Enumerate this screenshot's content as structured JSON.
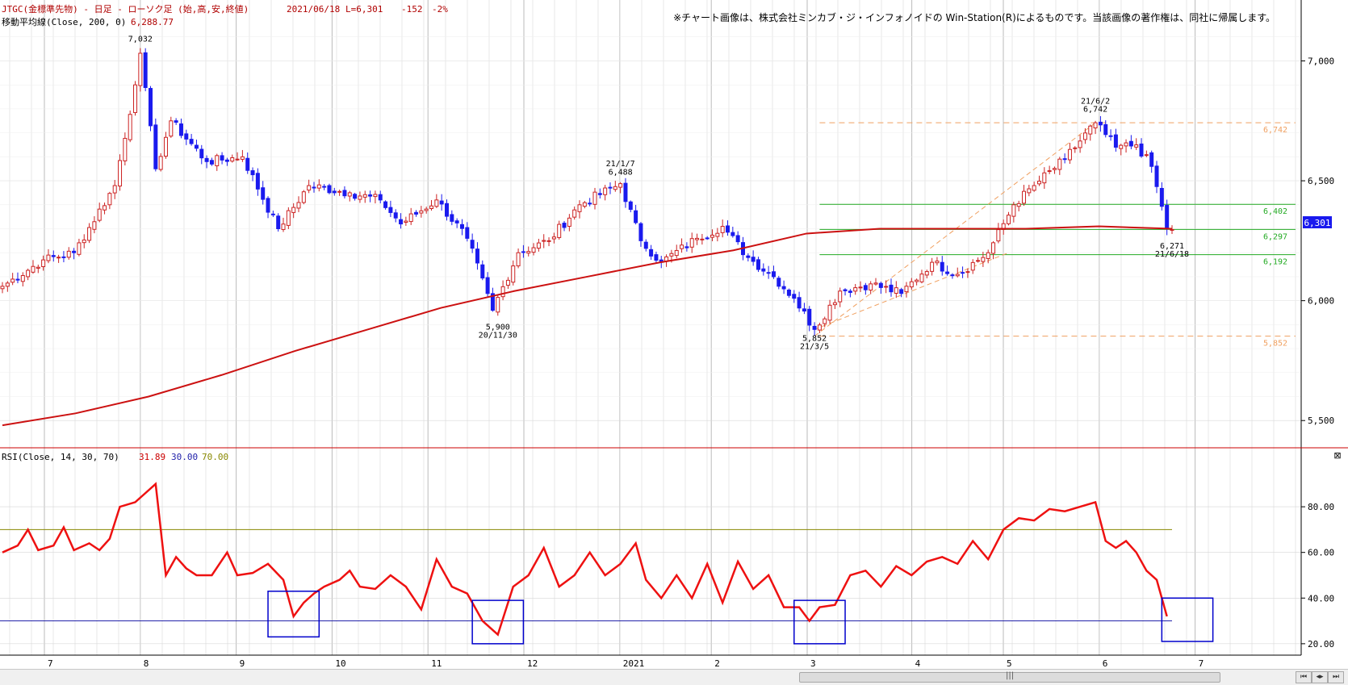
{
  "header": {
    "title": "JTGC(金標準先物) - 日足 - ローソク足 (始,高,安,終値)",
    "date": "2021/06/18",
    "last": "L=6,301",
    "change": "-152",
    "pct": "-2%",
    "ma_label": "移動平均線(Close, 200, 0)",
    "ma_value": "6,288.77",
    "copyright": "※チャート画像は、株式会社ミンカブ・ジ・インフォノイドの Win-Station(R)によるものです。当該画像の著作権は、同社に帰属します。"
  },
  "rsi_header": {
    "label": "RSI(Close, 14, 30, 70)",
    "value": "31.89",
    "lower": "30.00",
    "upper": "70.00"
  },
  "colors": {
    "up": "#cc2222",
    "down": "#1a1aee",
    "ma": "#cc1111",
    "rsi": "#ee1111",
    "level_lower": "#2222aa",
    "level_upper": "#888800",
    "support": "#22aa22",
    "dashed": "#f0a060",
    "grid": "#d8d8d8",
    "price_tag": "#1a1aee"
  },
  "chart_data": [
    {
      "type": "candlestick",
      "title": "JTGC(金標準先物) - 日足 - ローソク足 (始,高,安,終値)",
      "x_tick_labels": [
        "7",
        "8",
        "9",
        "10",
        "11",
        "12",
        "2021",
        "2",
        "3",
        "4",
        "5",
        "6",
        "7"
      ],
      "y_tick_labels": [
        "7,000",
        "6,500",
        "6,000",
        "5,500"
      ],
      "ylim": [
        5420,
        7180
      ],
      "moving_average": {
        "name": "移動平均線(Close, 200, 0)",
        "points": [
          [
            0,
            5480
          ],
          [
            15,
            5530
          ],
          [
            30,
            5600
          ],
          [
            45,
            5690
          ],
          [
            60,
            5790
          ],
          [
            75,
            5880
          ],
          [
            90,
            5970
          ],
          [
            105,
            6040
          ],
          [
            120,
            6100
          ],
          [
            135,
            6160
          ],
          [
            150,
            6210
          ],
          [
            165,
            6280
          ],
          [
            180,
            6300
          ],
          [
            195,
            6300
          ],
          [
            210,
            6300
          ],
          [
            225,
            6310
          ],
          [
            240,
            6300
          ]
        ]
      },
      "anchors": [
        {
          "i": 0,
          "p": 6060
        },
        {
          "i": 8,
          "p": 6170
        },
        {
          "i": 14,
          "p": 6200
        },
        {
          "i": 22,
          "p": 6480
        },
        {
          "i": 26,
          "p": 6900
        },
        {
          "i": 27,
          "p": 7032
        },
        {
          "i": 30,
          "p": 6550
        },
        {
          "i": 33,
          "p": 6750
        },
        {
          "i": 40,
          "p": 6580
        },
        {
          "i": 47,
          "p": 6600
        },
        {
          "i": 54,
          "p": 6300
        },
        {
          "i": 60,
          "p": 6480
        },
        {
          "i": 68,
          "p": 6450
        },
        {
          "i": 74,
          "p": 6420
        },
        {
          "i": 78,
          "p": 6320
        },
        {
          "i": 85,
          "p": 6420
        },
        {
          "i": 91,
          "p": 6260
        },
        {
          "i": 96,
          "p": 5960
        },
        {
          "i": 101,
          "p": 6200
        },
        {
          "i": 107,
          "p": 6250
        },
        {
          "i": 113,
          "p": 6400
        },
        {
          "i": 121,
          "p": 6488
        },
        {
          "i": 125,
          "p": 6250
        },
        {
          "i": 129,
          "p": 6160
        },
        {
          "i": 136,
          "p": 6260
        },
        {
          "i": 141,
          "p": 6310
        },
        {
          "i": 146,
          "p": 6180
        },
        {
          "i": 151,
          "p": 6100
        },
        {
          "i": 155,
          "p": 6010
        },
        {
          "i": 159,
          "p": 5880
        },
        {
          "i": 164,
          "p": 6040
        },
        {
          "i": 170,
          "p": 6070
        },
        {
          "i": 176,
          "p": 6030
        },
        {
          "i": 182,
          "p": 6160
        },
        {
          "i": 187,
          "p": 6110
        },
        {
          "i": 193,
          "p": 6200
        },
        {
          "i": 198,
          "p": 6400
        },
        {
          "i": 202,
          "p": 6480
        },
        {
          "i": 208,
          "p": 6590
        },
        {
          "i": 214,
          "p": 6742
        },
        {
          "i": 218,
          "p": 6640
        },
        {
          "i": 222,
          "p": 6650
        },
        {
          "i": 225,
          "p": 6560
        },
        {
          "i": 228,
          "p": 6301
        }
      ],
      "annotations": [
        {
          "label": "7,032",
          "i": 27,
          "p": 7080,
          "a": "middle"
        },
        {
          "label": "5,900",
          "i": 97,
          "p": 5880,
          "a": "middle"
        },
        {
          "label": "20/11/30",
          "i": 97,
          "p": 5846,
          "a": "middle"
        },
        {
          "label": "21/1/7",
          "i": 121,
          "p": 6560,
          "a": "middle"
        },
        {
          "label": "6,488",
          "i": 121,
          "p": 6526,
          "a": "middle"
        },
        {
          "label": "5,852",
          "i": 159,
          "p": 5832,
          "a": "middle"
        },
        {
          "label": "21/3/5",
          "i": 159,
          "p": 5798,
          "a": "middle"
        },
        {
          "label": "21/6/2",
          "i": 214,
          "p": 6822,
          "a": "middle"
        },
        {
          "label": "6,742",
          "i": 214,
          "p": 6788,
          "a": "middle"
        },
        {
          "label": "6,271",
          "i": 229,
          "p": 6218,
          "a": "middle"
        },
        {
          "label": "21/6/18",
          "i": 229,
          "p": 6184,
          "a": "middle"
        }
      ],
      "horizontal_lines": [
        {
          "value": 6742,
          "label": "6,742",
          "style": "dashed",
          "color": "#f0a060"
        },
        {
          "value": 6402,
          "label": "6,402",
          "style": "solid",
          "color": "#22aa22"
        },
        {
          "value": 6297,
          "label": "6,297",
          "style": "solid",
          "color": "#22aa22"
        },
        {
          "value": 6192,
          "label": "6,192",
          "style": "solid",
          "color": "#22aa22"
        },
        {
          "value": 5852,
          "label": "5,852",
          "style": "dashed",
          "color": "#f0a060"
        }
      ],
      "last_price_tag": "6,301"
    },
    {
      "type": "line",
      "title": "RSI(Close, 14, 30, 70)",
      "y_tick_labels": [
        "80.00",
        "60.00",
        "40.00",
        "20.00"
      ],
      "ylim": [
        15,
        97
      ],
      "levels": [
        30,
        70
      ],
      "series": [
        {
          "name": "RSI",
          "points": [
            [
              0,
              60
            ],
            [
              3,
              63
            ],
            [
              5,
              70
            ],
            [
              7,
              61
            ],
            [
              10,
              63
            ],
            [
              12,
              71
            ],
            [
              14,
              61
            ],
            [
              17,
              64
            ],
            [
              19,
              61
            ],
            [
              21,
              66
            ],
            [
              23,
              80
            ],
            [
              26,
              82
            ],
            [
              28,
              86
            ],
            [
              30,
              90
            ],
            [
              32,
              50
            ],
            [
              34,
              58
            ],
            [
              36,
              53
            ],
            [
              38,
              50
            ],
            [
              41,
              50
            ],
            [
              44,
              60
            ],
            [
              46,
              50
            ],
            [
              49,
              51
            ],
            [
              52,
              55
            ],
            [
              55,
              48
            ],
            [
              57,
              32
            ],
            [
              59,
              38
            ],
            [
              61,
              42
            ],
            [
              63,
              45
            ],
            [
              66,
              48
            ],
            [
              68,
              52
            ],
            [
              70,
              45
            ],
            [
              73,
              44
            ],
            [
              76,
              50
            ],
            [
              79,
              45
            ],
            [
              82,
              35
            ],
            [
              85,
              57
            ],
            [
              88,
              45
            ],
            [
              91,
              42
            ],
            [
              94,
              30
            ],
            [
              97,
              24
            ],
            [
              100,
              45
            ],
            [
              103,
              50
            ],
            [
              106,
              62
            ],
            [
              109,
              45
            ],
            [
              112,
              50
            ],
            [
              115,
              60
            ],
            [
              118,
              50
            ],
            [
              121,
              55
            ],
            [
              124,
              64
            ],
            [
              126,
              48
            ],
            [
              129,
              40
            ],
            [
              132,
              50
            ],
            [
              135,
              40
            ],
            [
              138,
              55
            ],
            [
              141,
              38
            ],
            [
              144,
              56
            ],
            [
              147,
              44
            ],
            [
              150,
              50
            ],
            [
              153,
              36
            ],
            [
              156,
              36
            ],
            [
              158,
              30
            ],
            [
              160,
              36
            ],
            [
              163,
              37
            ],
            [
              166,
              50
            ],
            [
              169,
              52
            ],
            [
              172,
              45
            ],
            [
              175,
              54
            ],
            [
              178,
              50
            ],
            [
              181,
              56
            ],
            [
              184,
              58
            ],
            [
              187,
              55
            ],
            [
              190,
              65
            ],
            [
              193,
              57
            ],
            [
              196,
              70
            ],
            [
              199,
              75
            ],
            [
              202,
              74
            ],
            [
              205,
              79
            ],
            [
              208,
              78
            ],
            [
              211,
              80
            ],
            [
              214,
              82
            ],
            [
              216,
              65
            ],
            [
              218,
              62
            ],
            [
              220,
              65
            ],
            [
              222,
              60
            ],
            [
              224,
              52
            ],
            [
              226,
              48
            ],
            [
              228,
              32
            ]
          ]
        }
      ],
      "boxes": [
        {
          "i0": 52,
          "i1": 62,
          "v0": 23,
          "v1": 43
        },
        {
          "i0": 92,
          "i1": 102,
          "v0": 20,
          "v1": 39
        },
        {
          "i0": 155,
          "i1": 165,
          "v0": 20,
          "v1": 39
        },
        {
          "i0": 227,
          "i1": 237,
          "v0": 21,
          "v1": 40
        }
      ]
    }
  ]
}
